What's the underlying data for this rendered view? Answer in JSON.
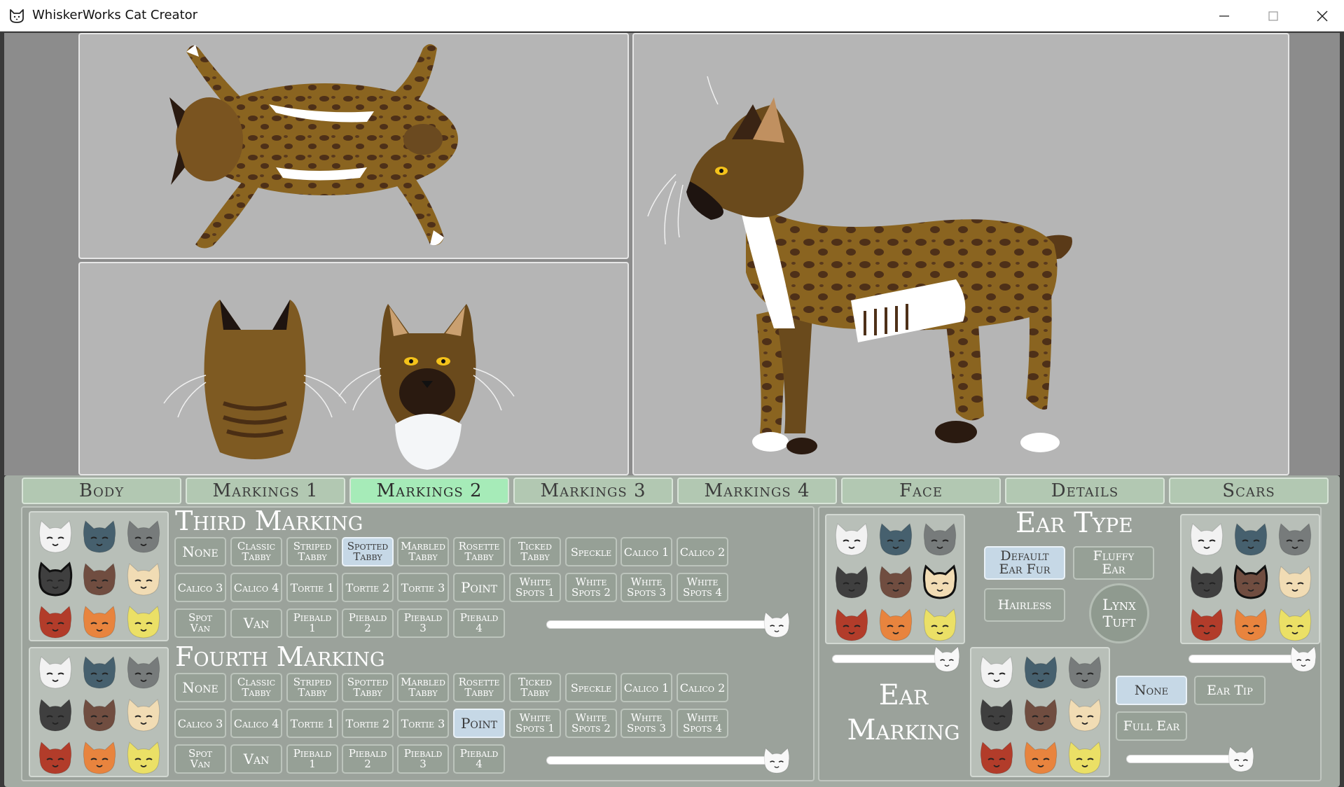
{
  "window": {
    "title": "WhiskerWorks Cat Creator",
    "controls": [
      "minimize-icon",
      "maximize-icon",
      "close-icon"
    ]
  },
  "tabs": [
    {
      "label": "Body",
      "active": false
    },
    {
      "label": "Markings 1",
      "active": false
    },
    {
      "label": "Markings 2",
      "active": true
    },
    {
      "label": "Markings 3",
      "active": false
    },
    {
      "label": "Markings 4",
      "active": false
    },
    {
      "label": "Face",
      "active": false
    },
    {
      "label": "Details",
      "active": false
    },
    {
      "label": "Scars",
      "active": false
    }
  ],
  "palette_colors": [
    "#f2f2f2",
    "#46606e",
    "#777b7b",
    "#3f3f3f",
    "#704d40",
    "#f1dcb4",
    "#b23c2a",
    "#e8843e",
    "#ebe066"
  ],
  "third_marking": {
    "title": "Third Marking",
    "selected_color": 3,
    "buttons": [
      {
        "label": "None",
        "selected": false
      },
      {
        "label": "Classic\nTabby",
        "selected": false
      },
      {
        "label": "Striped\nTabby",
        "selected": false
      },
      {
        "label": "Spotted\nTabby",
        "selected": true
      },
      {
        "label": "Marbled\nTabby",
        "selected": false
      },
      {
        "label": "Rosette\nTabby",
        "selected": false
      },
      {
        "label": "Ticked\nTabby",
        "selected": false
      },
      {
        "label": "Speckle",
        "selected": false
      },
      {
        "label": "Calico 1",
        "selected": false
      },
      {
        "label": "Calico 2",
        "selected": false
      },
      {
        "label": "Calico 3",
        "selected": false
      },
      {
        "label": "Calico 4",
        "selected": false
      },
      {
        "label": "Tortie 1",
        "selected": false
      },
      {
        "label": "Tortie 2",
        "selected": false
      },
      {
        "label": "Tortie 3",
        "selected": false
      },
      {
        "label": "Point",
        "selected": false
      },
      {
        "label": "White\nSpots 1",
        "selected": false
      },
      {
        "label": "White\nSpots 2",
        "selected": false
      },
      {
        "label": "White\nSpots 3",
        "selected": false
      },
      {
        "label": "White\nSpots 4",
        "selected": false
      },
      {
        "label": "Spot\nVan",
        "selected": false
      },
      {
        "label": "Van",
        "selected": false
      },
      {
        "label": "Piebald\n1",
        "selected": false
      },
      {
        "label": "Piebald\n2",
        "selected": false
      },
      {
        "label": "Piebald\n3",
        "selected": false
      },
      {
        "label": "Piebald\n4",
        "selected": false
      }
    ],
    "slider_value": 1.0
  },
  "fourth_marking": {
    "title": "Fourth Marking",
    "selected_color": -1,
    "buttons": [
      {
        "label": "None",
        "selected": false
      },
      {
        "label": "Classic\nTabby",
        "selected": false
      },
      {
        "label": "Striped\nTabby",
        "selected": false
      },
      {
        "label": "Spotted\nTabby",
        "selected": false
      },
      {
        "label": "Marbled\nTabby",
        "selected": false
      },
      {
        "label": "Rosette\nTabby",
        "selected": false
      },
      {
        "label": "Ticked\nTabby",
        "selected": false
      },
      {
        "label": "Speckle",
        "selected": false
      },
      {
        "label": "Calico 1",
        "selected": false
      },
      {
        "label": "Calico 2",
        "selected": false
      },
      {
        "label": "Calico 3",
        "selected": false
      },
      {
        "label": "Calico 4",
        "selected": false
      },
      {
        "label": "Tortie 1",
        "selected": false
      },
      {
        "label": "Tortie 2",
        "selected": false
      },
      {
        "label": "Tortie 3",
        "selected": false
      },
      {
        "label": "Point",
        "selected": true
      },
      {
        "label": "White\nSpots 1",
        "selected": false
      },
      {
        "label": "White\nSpots 2",
        "selected": false
      },
      {
        "label": "White\nSpots 3",
        "selected": false
      },
      {
        "label": "White\nSpots 4",
        "selected": false
      },
      {
        "label": "Spot\nVan",
        "selected": false
      },
      {
        "label": "Van",
        "selected": false
      },
      {
        "label": "Piebald\n1",
        "selected": false
      },
      {
        "label": "Piebald\n2",
        "selected": false
      },
      {
        "label": "Piebald\n3",
        "selected": false
      },
      {
        "label": "Piebald\n4",
        "selected": false
      }
    ],
    "slider_value": 1.0
  },
  "ear_type": {
    "title": "Ear Type",
    "buttons": [
      {
        "label": "Default\nEar Fur",
        "selected": true
      },
      {
        "label": "Fluffy\nEar",
        "selected": false
      },
      {
        "label": "Hairless",
        "selected": false
      },
      {
        "label": "Lynx\nTuft",
        "selected": false
      }
    ],
    "left_palette_selected": 5,
    "right_palette_selected": 4,
    "left_slider_value": 1.0,
    "right_slider_value": 1.0
  },
  "ear_marking": {
    "title": "Ear\nMarking",
    "buttons": [
      {
        "label": "None",
        "selected": true
      },
      {
        "label": "Ear Tip",
        "selected": false
      },
      {
        "label": "Full Ear",
        "selected": false
      }
    ],
    "slider_value": 1.0
  }
}
